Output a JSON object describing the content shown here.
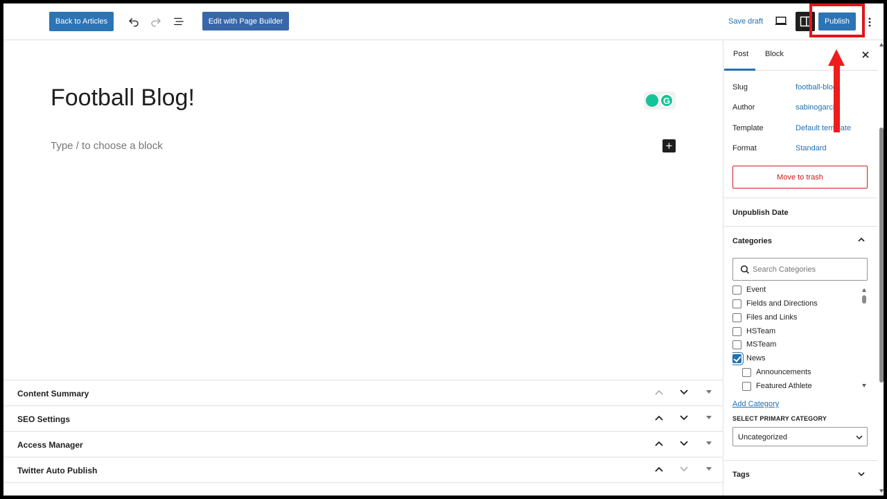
{
  "topbar": {
    "back_label": "Back to Articles",
    "page_builder_label": "Edit with Page Builder",
    "save_draft_label": "Save draft",
    "publish_label": "Publish"
  },
  "editor": {
    "title": "Football Blog!",
    "block_placeholder": "Type / to choose a block"
  },
  "metaboxes": [
    {
      "label": "Content Summary"
    },
    {
      "label": "SEO Settings"
    },
    {
      "label": "Access Manager"
    },
    {
      "label": "Twitter Auto Publish"
    }
  ],
  "sidebar": {
    "tabs": {
      "post": "Post",
      "block": "Block"
    },
    "properties": {
      "slug_label": "Slug",
      "slug_value": "football-blog",
      "author_label": "Author",
      "author_value": "sabinogarcia",
      "template_label": "Template",
      "template_value": "Default template",
      "format_label": "Format",
      "format_value": "Standard"
    },
    "trash_label": "Move to trash",
    "unpublish_label": "Unpublish Date",
    "categories_label": "Categories",
    "search_placeholder": "Search Categories",
    "categories": [
      {
        "label": "Event",
        "checked": false,
        "indent": 0
      },
      {
        "label": "Fields and Directions",
        "checked": false,
        "indent": 0
      },
      {
        "label": "Files and Links",
        "checked": false,
        "indent": 0
      },
      {
        "label": "HSTeam",
        "checked": false,
        "indent": 0
      },
      {
        "label": "MSTeam",
        "checked": false,
        "indent": 0
      },
      {
        "label": "News",
        "checked": true,
        "indent": 0
      },
      {
        "label": "Announcements",
        "checked": false,
        "indent": 1
      },
      {
        "label": "Featured Athlete",
        "checked": false,
        "indent": 1
      }
    ],
    "add_category_label": "Add Category",
    "primary_category_label": "SELECT PRIMARY CATEGORY",
    "primary_category_value": "Uncategorized",
    "tags_label": "Tags"
  },
  "colors": {
    "accent": "#2271b1",
    "button": "#2d74b5",
    "danger": "#cc1818",
    "annotation": "#ee1c1c"
  }
}
